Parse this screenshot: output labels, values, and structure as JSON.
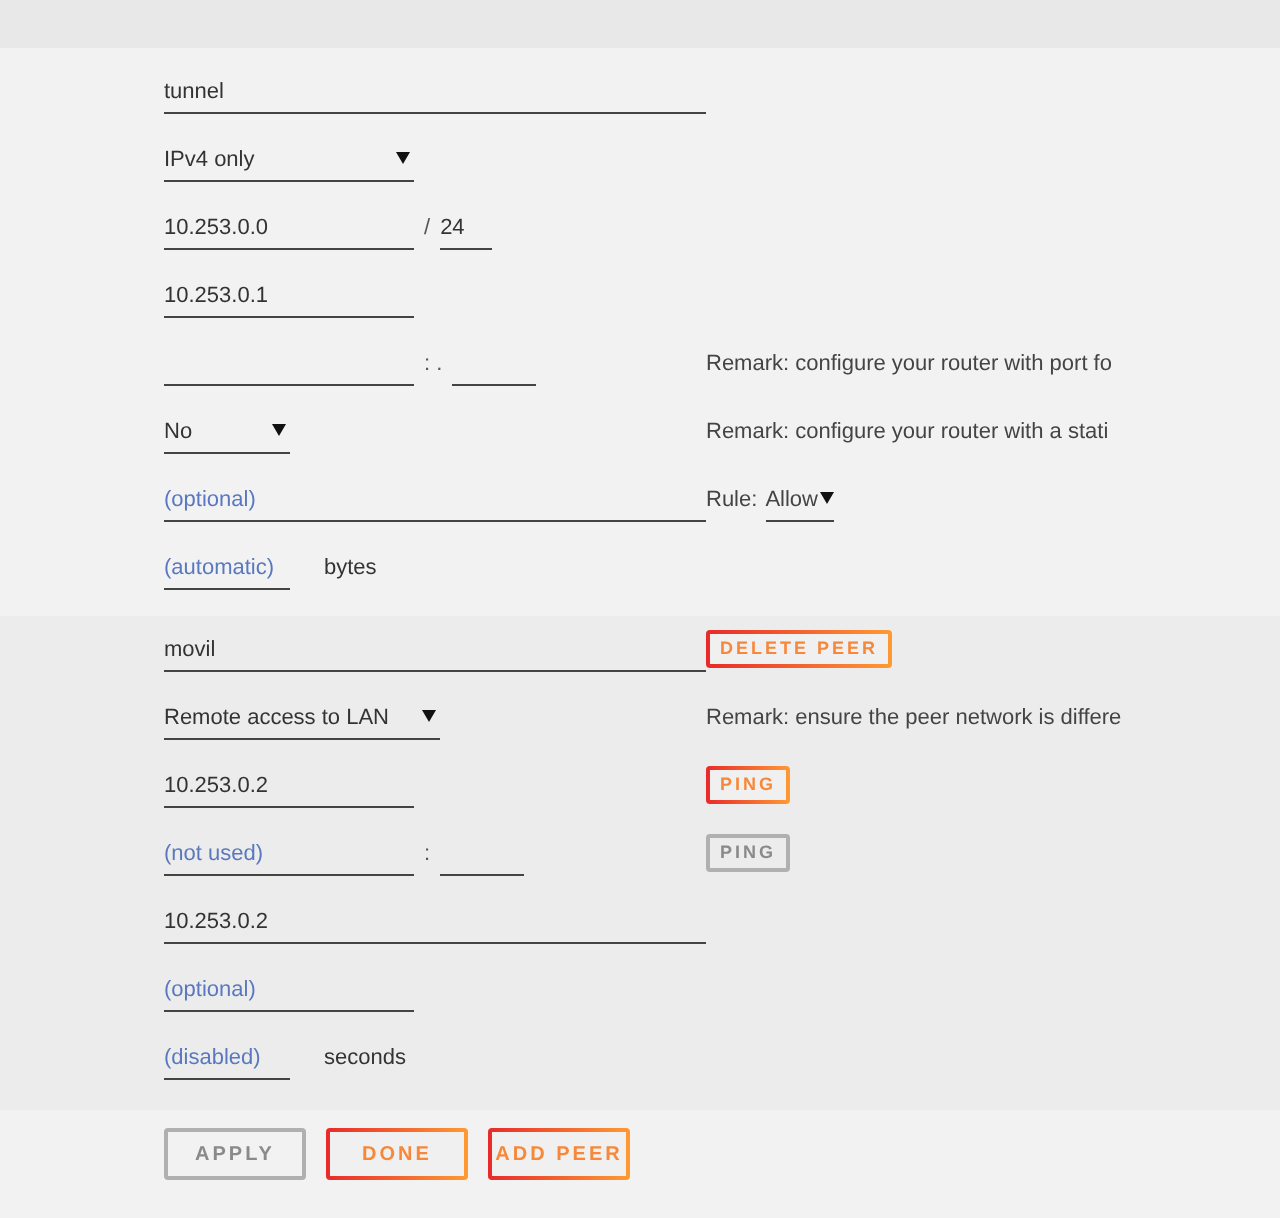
{
  "tunnel": {
    "name": "tunnel",
    "ip_version": "IPv4 only",
    "network": "10.253.0.0",
    "prefix_separator": "/",
    "prefix": "24",
    "address": "10.253.0.1",
    "endpoint_separator": ": .",
    "remark_port": "Remark: configure your router with port fo",
    "static_select": "No",
    "remark_static": "Remark: configure your router with a stati",
    "optional_placeholder": "(optional)",
    "rule_label": "Rule:",
    "rule_value": "Allow",
    "mtu_placeholder": "(automatic)",
    "mtu_unit": "bytes"
  },
  "peer": {
    "name": "movil",
    "delete_button": "DELETE PEER",
    "mode": "Remote access to LAN",
    "remark": "Remark: ensure the peer network is differe",
    "address": "10.253.0.2",
    "ping_buttons": [
      {
        "label": "PING",
        "disabled": false
      },
      {
        "label": "PING",
        "disabled": true
      }
    ],
    "endpoint_placeholder": "(not used)",
    "endpoint_separator": ":",
    "allowed": "10.253.0.2",
    "key_placeholder": "(optional)",
    "keepalive_placeholder": "(disabled)",
    "keepalive_unit": "seconds"
  },
  "buttons": [
    {
      "label": "APPLY",
      "disabled": true
    },
    {
      "label": "DONE",
      "disabled": false
    },
    {
      "label": "ADD PEER",
      "disabled": false
    }
  ]
}
